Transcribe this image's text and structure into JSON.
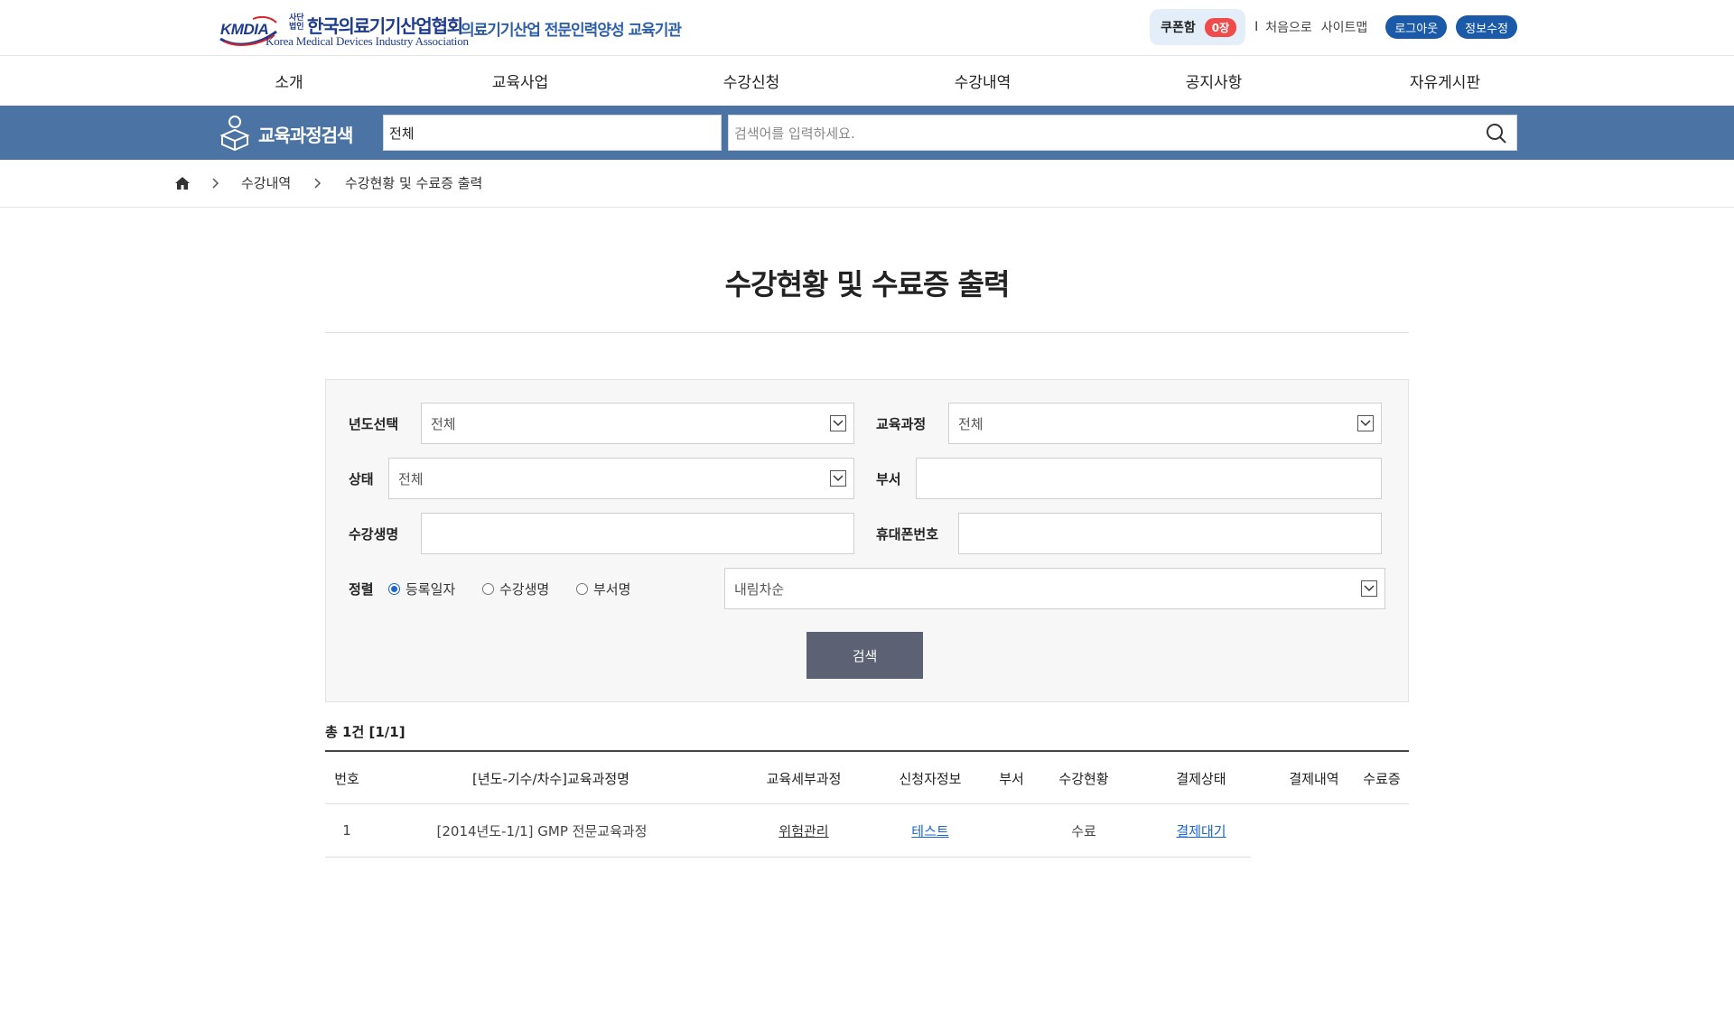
{
  "header": {
    "logo": {
      "mark": "KMDIA",
      "corp_type": "사단 법인",
      "name": "한국의료기기산업협회",
      "english_name": "Korea Medical Devices Industry Association",
      "subtitle": "의료기기산업 전문인력양성 교육기관"
    },
    "coupon": {
      "label": "쿠폰함",
      "count": "0장"
    },
    "separator": "I",
    "links": {
      "home": "처음으로",
      "sitemap": "사이트맵"
    },
    "buttons": {
      "logout": "로그아웃",
      "edit_info": "정보수정"
    },
    "colors": {
      "brand": "#1f3c8c",
      "button": "#1b5aa8",
      "badge": "#f04b4b"
    }
  },
  "gnb": {
    "items": [
      "소개",
      "교육사업",
      "수강신청",
      "수강내역",
      "공지사항",
      "자유게시판"
    ]
  },
  "search_band": {
    "title": "교육과정검색",
    "category_value": "전체",
    "placeholder": "검색어를 입력하세요.",
    "icon": "search-icon",
    "color": "#4b74a5"
  },
  "breadcrumb": {
    "icon": "home-icon",
    "items": [
      "수강내역",
      "수강현황 및 수료증 출력"
    ]
  },
  "page": {
    "title": "수강현황 및 수료증 출력"
  },
  "filters": {
    "year": {
      "label": "년도선택",
      "value": "전체"
    },
    "course": {
      "label": "교육과정",
      "value": "전체"
    },
    "status": {
      "label": "상태",
      "value": "전체"
    },
    "department": {
      "label": "부서",
      "value": ""
    },
    "student": {
      "label": "수강생명",
      "value": ""
    },
    "phone": {
      "label": "휴대폰번호",
      "value": ""
    },
    "sort": {
      "label": "정렬",
      "options": [
        "등록일자",
        "수강생명",
        "부서명"
      ],
      "selected": "등록일자",
      "order_value": "내림차순"
    },
    "search_button": "검색"
  },
  "results": {
    "total": "총 1건 [1/1]",
    "columns": [
      "번호",
      "[년도-기수/차수]교육과정명",
      "교육세부과정",
      "신청자정보",
      "부서",
      "수강현황",
      "결제상태",
      "결제내역",
      "수료증"
    ],
    "rows": [
      {
        "no": "1",
        "course": "[2014년도-1/1] GMP 전문교육과정",
        "detail": "위험관리",
        "applicant": "테스트",
        "department": "",
        "progress": "수료",
        "payment_status": "결제대기"
      }
    ]
  }
}
